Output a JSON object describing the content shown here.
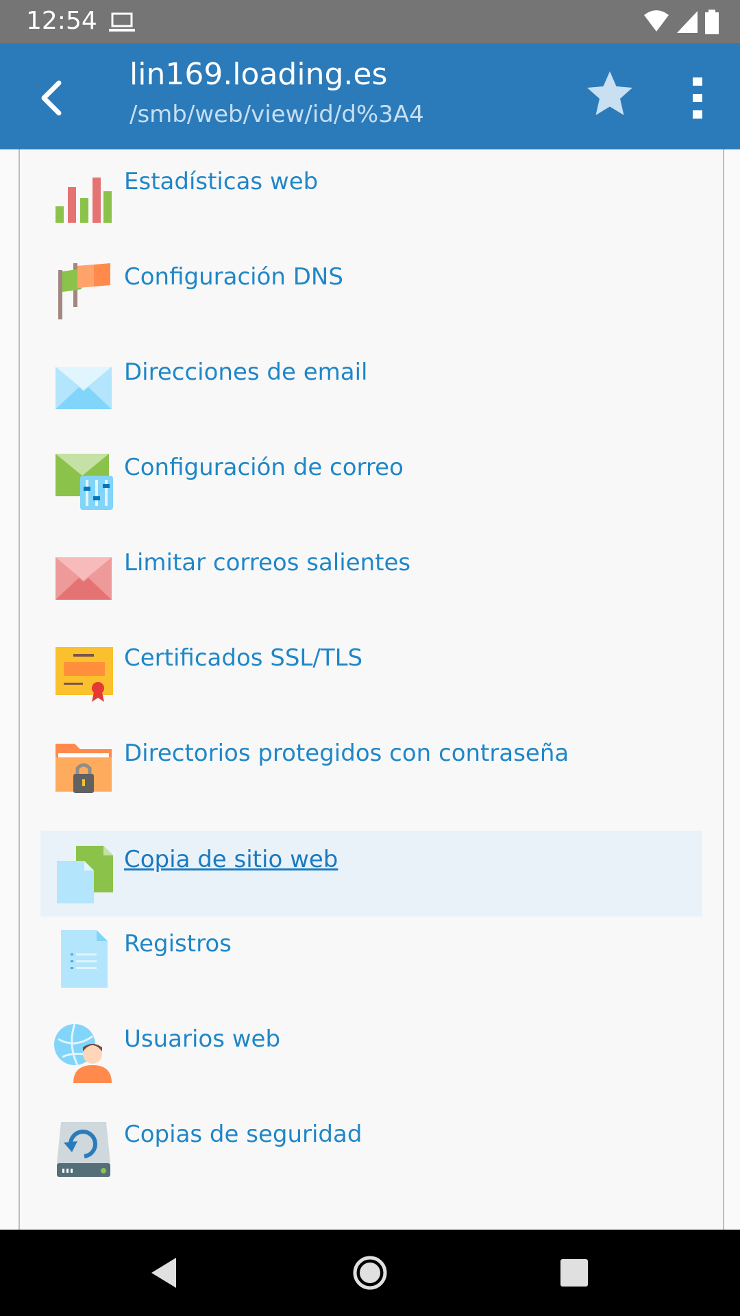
{
  "status_bar": {
    "time": "12:54",
    "icons": [
      "laptop-icon",
      "wifi-icon",
      "signal-icon",
      "battery-icon"
    ]
  },
  "app_bar": {
    "title": "lin169.loading.es",
    "subtitle": "/smb/web/view/id/d%3A4",
    "back_icon": "chevron-left-icon",
    "star_icon": "star-icon",
    "menu_icon": "overflow-menu-icon"
  },
  "menu": {
    "items": [
      {
        "label": "Estadísticas web",
        "icon": "bar-chart-icon"
      },
      {
        "label": "Configuración DNS",
        "icon": "flags-icon"
      },
      {
        "label": "Direcciones de email",
        "icon": "envelope-blue-icon"
      },
      {
        "label": "Configuración de correo",
        "icon": "mail-settings-icon"
      },
      {
        "label": "Limitar correos salientes",
        "icon": "envelope-red-icon"
      },
      {
        "label": "Certificados SSL/TLS",
        "icon": "certificate-icon"
      },
      {
        "label": "Directorios protegidos con contraseña",
        "icon": "locked-folder-icon"
      },
      {
        "label": "Copia de sitio web",
        "icon": "copy-files-icon",
        "active": true
      },
      {
        "label": "Registros",
        "icon": "log-document-icon"
      },
      {
        "label": "Usuarios web",
        "icon": "web-user-icon"
      },
      {
        "label": "Copias de seguridad",
        "icon": "backup-drive-icon"
      }
    ]
  },
  "colors": {
    "app_bar": "#2b7bbb",
    "status_bar": "#757575",
    "link": "#1f87c8",
    "active_row": "#e9f1f9"
  }
}
